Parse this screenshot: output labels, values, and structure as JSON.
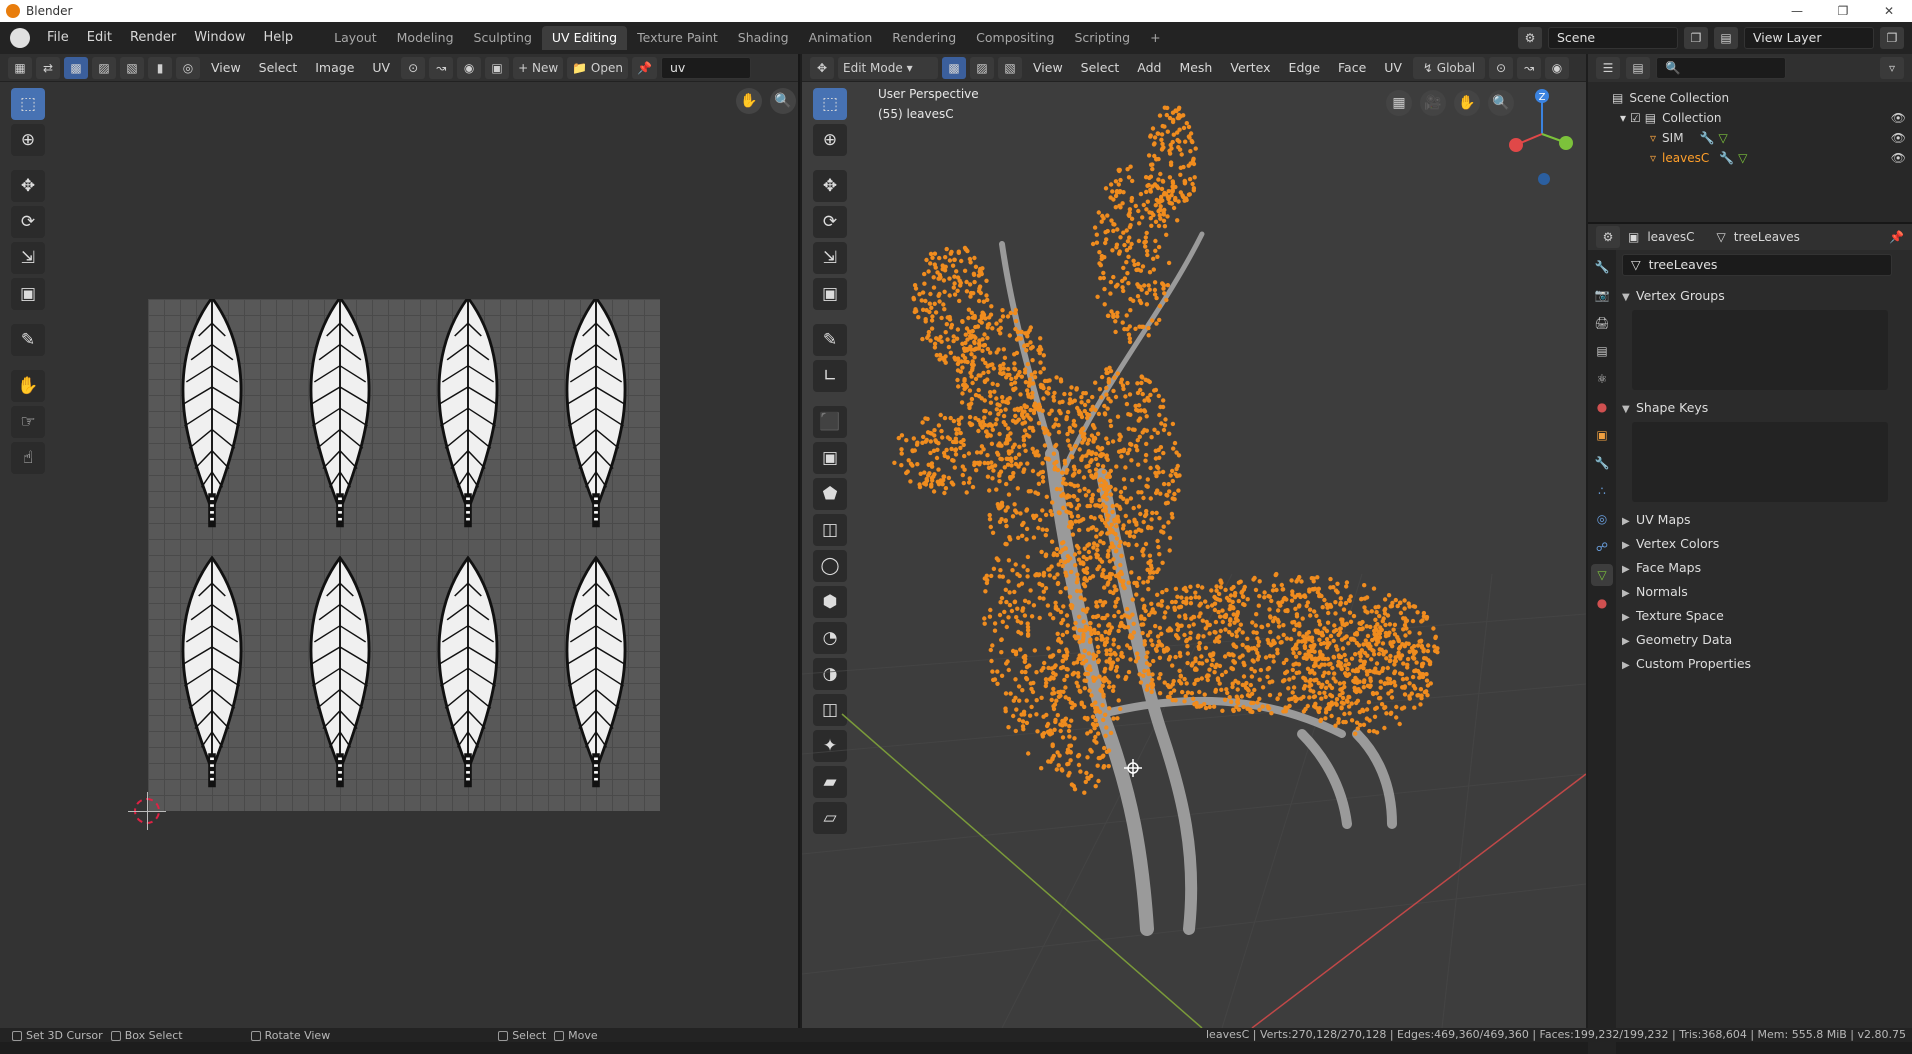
{
  "window": {
    "title": "Blender",
    "min_icon": "minimize-icon",
    "max_icon": "restore-icon",
    "close_icon": "close-icon"
  },
  "topbar": {
    "menus": [
      "File",
      "Edit",
      "Render",
      "Window",
      "Help"
    ],
    "workspaces": [
      "Layout",
      "Modeling",
      "Sculpting",
      "UV Editing",
      "Texture Paint",
      "Shading",
      "Animation",
      "Rendering",
      "Compositing",
      "Scripting"
    ],
    "active_workspace": "UV Editing",
    "add_workspace": "+",
    "scene": "Scene",
    "view_layer": "View Layer"
  },
  "uv_editor": {
    "menus": [
      "View",
      "Select",
      "Image",
      "UV"
    ],
    "new_label": "New",
    "open_label": "Open",
    "image_name": "uv",
    "tools": [
      "select-box-icon",
      "cursor-icon",
      "move-icon",
      "rotate-icon",
      "scale-icon",
      "transform-icon",
      "annotate-icon",
      "grab-icon",
      "relax-icon",
      "pinch-icon"
    ]
  },
  "viewport": {
    "mode": "Edit Mode",
    "menus": [
      "View",
      "Select",
      "Add",
      "Mesh",
      "Vertex",
      "Edge",
      "Face",
      "UV"
    ],
    "orientation": "Global",
    "perspective_label": "User Perspective",
    "object_label": "(55) leavesC",
    "gizmo": {
      "z_label": "Z",
      "x_color": "#e04848",
      "y_color": "#7cc23b",
      "z_color": "#3b83e0"
    },
    "accent_color": "#f08c1e"
  },
  "outliner": {
    "search_placeholder": "",
    "scene_collection": "Scene Collection",
    "collection": "Collection",
    "objects": [
      {
        "name": "SIM",
        "selected": false
      },
      {
        "name": "leavesC",
        "selected": true
      }
    ]
  },
  "properties": {
    "object_name": "leavesC",
    "data_name": "treeLeaves",
    "mesh_field": "treeLeaves",
    "panels": {
      "vertex_groups": "Vertex Groups",
      "shape_keys": "Shape Keys",
      "collapsed": [
        "UV Maps",
        "Vertex Colors",
        "Face Maps",
        "Normals",
        "Texture Space",
        "Geometry Data",
        "Custom Properties"
      ]
    }
  },
  "statusbar": {
    "hints": [
      "Set 3D Cursor",
      "Box Select",
      "Rotate View",
      "Select",
      "Move"
    ],
    "stats": "leavesC | Verts:270,128/270,128 | Edges:469,360/469,360 | Faces:199,232/199,232 | Tris:368,604 | Mem: 555.8 MiB | v2.80.75"
  }
}
